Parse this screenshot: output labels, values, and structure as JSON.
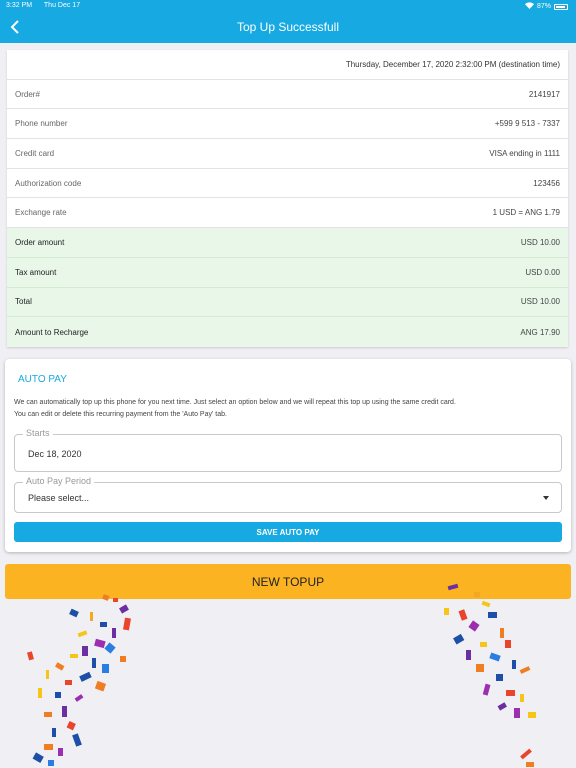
{
  "status_bar": {
    "time": "3:32 PM",
    "date": "Thu Dec 17",
    "battery": "87%",
    "wifi_icon": "wifi-icon",
    "battery_icon": "battery-icon"
  },
  "header": {
    "title": "Top Up Successfull",
    "back_icon": "chevron-left-icon"
  },
  "summary": {
    "datetime": "Thursday, December 17, 2020 2:32:00 PM (destination time)",
    "rows": [
      {
        "label": "Order#",
        "value": "2141917"
      },
      {
        "label": "Phone number",
        "value": "+599 9 513 - 7337"
      },
      {
        "label": "Credit card",
        "value": "VISA ending in 1111"
      },
      {
        "label": "Authorization code",
        "value": "123456"
      },
      {
        "label": "Exchange rate",
        "value": "1 USD = ANG 1.79"
      }
    ],
    "totals": [
      {
        "label": "Order amount",
        "value": "USD 10.00"
      },
      {
        "label": "Tax amount",
        "value": "USD 0.00"
      },
      {
        "label": "Total",
        "value": "USD 10.00"
      },
      {
        "label": "Amount to Recharge",
        "value": "ANG 17.90"
      }
    ]
  },
  "autopay": {
    "title": "AUTO PAY",
    "description_line1": "We can automatically top up this phone for you next time. Just select an option below and we will repeat this top up using the same credit card.",
    "description_line2": "You can edit or delete this recurring payment from the 'Auto Pay' tab.",
    "starts_label": "Starts",
    "starts_value": "Dec 18, 2020",
    "period_label": "Auto Pay Period",
    "period_value": "Please select...",
    "save_label": "SAVE AUTO PAY"
  },
  "new_topup_label": "NEW TOPUP",
  "colors": {
    "accent": "#17a9e1",
    "button_yellow": "#fbb322",
    "green_row": "#e8f7e8"
  }
}
